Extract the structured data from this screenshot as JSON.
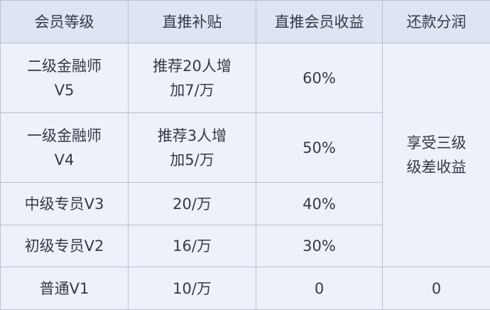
{
  "headers": [
    "会员等级",
    "直推补贴",
    "直推会员收益",
    "还款分润"
  ],
  "rows": [
    {
      "level_line1": "二级金融师",
      "level_line2": "V5",
      "subsidy_line1": "推荐20人增",
      "subsidy_line2": "加7/万",
      "member_income": "60%"
    },
    {
      "level_line1": "一级金融师",
      "level_line2": "V4",
      "subsidy_line1": "推荐3人增",
      "subsidy_line2": "加5/万",
      "member_income": "50%"
    },
    {
      "level": "中级专员V3",
      "subsidy": "20/万",
      "member_income": "40%"
    },
    {
      "level": "初级专员V2",
      "subsidy": "16/万",
      "member_income": "30%"
    },
    {
      "level": "普通V1",
      "subsidy": "10/万",
      "member_income": "0",
      "repayment_share": "0"
    }
  ],
  "merged_repayment_share": {
    "line1": "享受三级",
    "line2": "级差收益"
  },
  "colors": {
    "header_bg": "#dfe4f3",
    "cell_bg": "#eef1fa",
    "border": "#b8bfce",
    "text": "#333a47"
  }
}
